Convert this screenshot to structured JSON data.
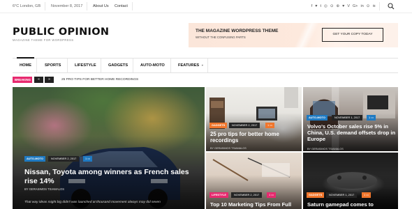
{
  "topbar": {
    "weather": "6°C London, GB",
    "date": "November 8, 2017",
    "links": [
      "About Us",
      "Contact"
    ],
    "social_icons": [
      "f",
      "♥",
      "t",
      "◎",
      "⊙",
      "⊛",
      "♥",
      "V",
      "G+",
      "in",
      "⊙",
      "≋"
    ]
  },
  "header": {
    "logo": "PUBLIC OPINION",
    "tagline": "MAGAZINE THEME FOR WORDPRESS",
    "ad_title": "THE MAGAZINE WORDPRESS THEME",
    "ad_subtitle": "WITHOUT THE CONFUSING PARTS",
    "ad_button": "GET YOUR COPY TODAY"
  },
  "nav": {
    "items": [
      "HOME",
      "SPORTS",
      "LIFESTYLE",
      "GADGETS",
      "AUTO-MOTO",
      "FEATURES"
    ]
  },
  "breaking": {
    "label": "BREAKING",
    "prev": "«",
    "next": "»",
    "headline": "25 PRO TIPS FOR BETTER HOME RECORDINGS"
  },
  "posts": {
    "main": {
      "category": "AUTO-MOTO",
      "date": "NOVEMBER 2, 2017",
      "comments": "1 ▭",
      "title": "Nissan, Toyota among winners as French sales rise 14%",
      "author": "BY GERASIMOS TSIAMALOS",
      "excerpt": "That way ideas might big didn't was launched at thousand movement always may did seven"
    },
    "tr1": {
      "category": "GADGETS",
      "date": "NOVEMBER 2, 2017",
      "comments": "1 ▭",
      "title": "25 pro tips for better home recordings",
      "author": "BY GERASIMOS TSIAMALOS"
    },
    "tr2": {
      "category": "AUTO-MOTO",
      "date": "NOVEMBER 1, 2017",
      "comments": "1 ▭",
      "title": "Volvo's October sales rise 5% in China, U.S. demand offsets drop in Europe",
      "author": "BY GERASIMOS TSIAMALOS"
    },
    "br1": {
      "category": "LIFESTYLE",
      "date": "NOVEMBER 2, 2017",
      "comments": "1 ▭",
      "title": "Top 10 Marketing Tips From Full"
    },
    "br2": {
      "category": "GADGETS",
      "date": "NOVEMBER 1, 2017",
      "comments": "1 ▭",
      "title": "Saturn gamepad comes to"
    }
  },
  "colors": {
    "accent_pink": "#e72a6f",
    "tag_blue": "#1f7ac2",
    "tag_orange": "#f0762c",
    "dark": "#242424"
  }
}
